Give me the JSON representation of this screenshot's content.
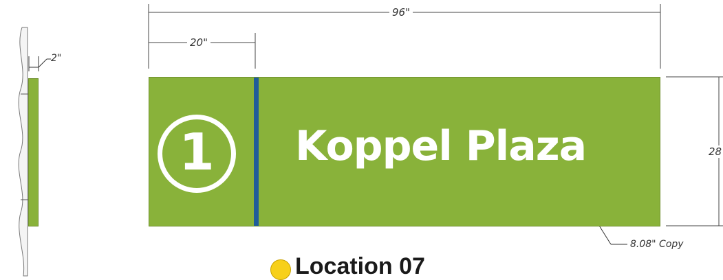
{
  "dimensions": {
    "overall_width": "96\"",
    "panel_width": "20\"",
    "height": "28",
    "depth": "2\""
  },
  "sign": {
    "number": "1",
    "name": "Koppel Plaza",
    "background_color": "#89b23a",
    "divider_color": "#1f5d9a",
    "text_color": "#ffffff"
  },
  "callout": {
    "copy_height": "8.08\" Copy"
  },
  "location": {
    "title": "Location 07",
    "marker_color": "#f7d01a"
  }
}
